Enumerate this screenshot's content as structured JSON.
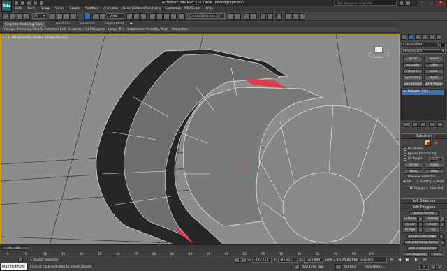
{
  "app": {
    "title": "Autodesk 3ds Max 2013 x64",
    "file": "Phonograph.max",
    "search_placeholder": "Type a keyword or phrase",
    "logo_text": "3ds"
  },
  "menu": [
    "Edit",
    "Tools",
    "Group",
    "Views",
    "Create",
    "Modifiers",
    "Animation",
    "Graph Editors",
    "Rendering",
    "Customize",
    "MAXScript",
    "Help"
  ],
  "main_toolbar": {
    "selection_filter": "All",
    "reference_coord": "View",
    "named_selection": "Create Selection Se"
  },
  "ribbon": {
    "tabs": [
      "Graphite Modeling Tools",
      "Freeform",
      "Selection",
      "Object Paint"
    ],
    "subtabs": [
      "Polygon Modeling",
      "Modify Selection",
      "Edit",
      "Geometry (All)",
      "Polygons",
      "Loops",
      "Tris",
      "Subdivision",
      "Visibility",
      "Align",
      "Properties"
    ]
  },
  "viewport": {
    "label": "[ + ] [ Perspective ] [ Shaded + Edged Faces ]",
    "background": "#8c8c8c"
  },
  "command_panel": {
    "object_name": "Cylinder004",
    "modifier_list": "Modifier List",
    "modifier_buttons": [
      [
        "Bend",
        "Bevel"
      ],
      [
        "Extrude",
        "Lathe"
      ],
      [
        "FFD 3x3x3",
        "Shell"
      ],
      [
        "Symmetry",
        "Taper"
      ],
      [
        "TurboSmooth",
        "UVW Mapping Cle"
      ]
    ],
    "stack_item": "Editable Poly",
    "selection_rollout": "Selection",
    "by_vertex": "By Vertex",
    "ignore_backfacing": "Ignore Backfacing",
    "by_angle": "By Angle:",
    "by_angle_value": "45.0",
    "shrink": "Shrink",
    "grow": "Grow",
    "ring": "Ring",
    "loop": "Loop",
    "preview_selection": "Preview Selection",
    "preview_options": [
      "Off",
      "SubObj",
      "Multi"
    ],
    "selected_count": "16 Polygons Selected",
    "soft_selection": "Soft Selection",
    "edit_polygons": "Edit Polygons",
    "insert_vertex": "Insert Vertex",
    "edit_buttons": [
      [
        "Extrude",
        "Outline"
      ],
      [
        "Bevel",
        "Inset"
      ],
      [
        "Bridge",
        "Flip"
      ]
    ],
    "hinge": "Hinge From Edge",
    "extrude_spline": "Extrude Along Spline",
    "edit_triangulation": "Edit Triangulation",
    "retriangulate": "Retriangulate",
    "turn": "Turn"
  },
  "timeline": {
    "frame_counter": "0 / 100",
    "ticks": [
      "0",
      "5",
      "10",
      "15",
      "20",
      "25",
      "30",
      "35",
      "40",
      "45",
      "50",
      "55",
      "60",
      "65",
      "70",
      "75",
      "80",
      "85",
      "90",
      "95",
      "100"
    ]
  },
  "status": {
    "maxscript_label": "Max to Physc",
    "selected_text": "1 Object Selected",
    "prompt": "Click or click-and-drag to select objects",
    "x_label": "X:",
    "x_value": "-387.751",
    "y_label": "Y:",
    "y_value": "-92.012",
    "z_label": "Z:",
    "z_value": "-128.894",
    "grid": "Grid = 10.0",
    "auto_key": "Auto Key",
    "set_key": "Set Key",
    "key_mode_select": "Selected",
    "key_filters": "Key Filters...",
    "add_time_tag": "Add Time Tag",
    "frame_field": "0"
  }
}
